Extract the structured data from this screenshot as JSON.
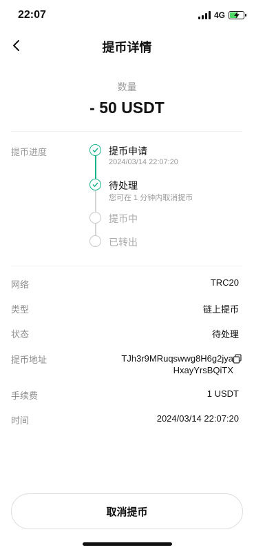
{
  "status_bar": {
    "time": "22:07",
    "network": "4G",
    "battery_level": 0.6,
    "battery_color": "#4cd964"
  },
  "nav": {
    "back_icon": "chevron-left-icon",
    "title": "提币详情"
  },
  "amount": {
    "label": "数量",
    "value": "- 50 USDT"
  },
  "progress": {
    "title": "提币进度",
    "accent": "#16b38a",
    "steps": [
      {
        "label": "提币申请",
        "sub": "2024/03/14 22:07:20",
        "state": "done"
      },
      {
        "label": "待处理",
        "sub": "您可在 1 分钟内取消提币",
        "state": "done"
      },
      {
        "label": "提币中",
        "sub": "",
        "state": "pending"
      },
      {
        "label": "已转出",
        "sub": "",
        "state": "pending"
      }
    ]
  },
  "details": {
    "network": {
      "label": "网络",
      "value": "TRC20"
    },
    "type": {
      "label": "类型",
      "value": "链上提币"
    },
    "status": {
      "label": "状态",
      "value": "待处理"
    },
    "address": {
      "label": "提币地址",
      "line1": "TJh3r9MRuqswwg8H6g2jya",
      "line2": "HxayYrsBQiTX",
      "icon": "copy-icon"
    },
    "fee": {
      "label": "手续费",
      "value": "1 USDT"
    },
    "time": {
      "label": "时间",
      "value": "2024/03/14 22:07:20"
    }
  },
  "actions": {
    "cancel_label": "取消提币"
  }
}
